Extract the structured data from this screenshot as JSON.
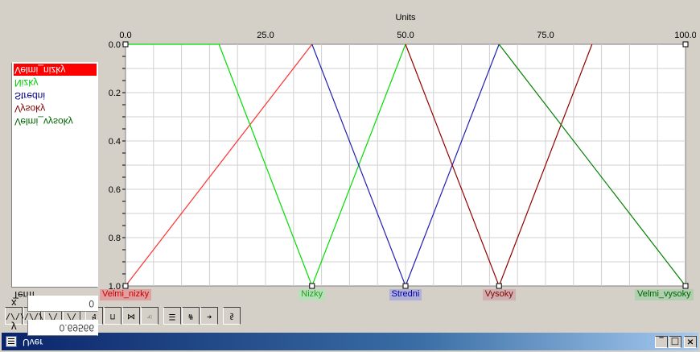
{
  "window": {
    "title": "Uver"
  },
  "titlebar_buttons": [
    "_",
    "□",
    "×"
  ],
  "toolbar": {
    "buttons": [
      {
        "name": "zoom-button-1",
        "label": "\\/\\/"
      },
      {
        "name": "zoom-button-2",
        "label": "\\/\\/"
      },
      {
        "name": "triangle-button",
        "label": "/\\"
      },
      {
        "name": "peak-button",
        "label": "/\\"
      },
      {
        "name": "tool-button-a",
        "label": "↯"
      },
      {
        "name": "tool-button-b",
        "label": "⊓"
      },
      {
        "name": "tool-button-c",
        "label": "⋈"
      },
      {
        "name": "hand-button",
        "label": "☜"
      },
      {
        "name": "list-button",
        "label": "☰"
      },
      {
        "name": "grid-button",
        "label": "#"
      },
      {
        "name": "arrow-button",
        "label": "➜"
      },
      {
        "name": "help-button",
        "label": "§"
      }
    ]
  },
  "term_panel": {
    "label": "Term",
    "terms": [
      {
        "label": "Velmi_nizky",
        "color": "#ff0000",
        "selected": true
      },
      {
        "label": "Nizky",
        "color": "#00cc00"
      },
      {
        "label": "Stredni",
        "color": "#000080"
      },
      {
        "label": "Vysoky",
        "color": "#800000"
      },
      {
        "label": "Velmi_vysoky",
        "color": "#006400"
      }
    ]
  },
  "readouts": {
    "x_label": "x",
    "x_value": "0",
    "y_label": "y",
    "y_value": "0.69566"
  },
  "chart_data": {
    "type": "line",
    "xlabel": "Units",
    "xlim": [
      0,
      100
    ],
    "ylim": [
      0,
      1
    ],
    "x_ticks": [
      "0.0",
      "25.0",
      "50.0",
      "75.0",
      "100.0"
    ],
    "y_ticks": [
      "0.0",
      "0.2",
      "0.4",
      "0.6",
      "0.8",
      "1.0"
    ],
    "series": [
      {
        "name": "Velmi_nizky",
        "color": "#ff3030",
        "x": [
          0,
          33.3
        ],
        "y": [
          1,
          0
        ]
      },
      {
        "name": "Nizky",
        "color": "#00dd00",
        "x": [
          0,
          16.7,
          33.3,
          50
        ],
        "y": [
          0,
          0,
          1,
          0
        ]
      },
      {
        "name": "Stredni",
        "color": "#2020b0",
        "x": [
          33.3,
          50,
          66.7
        ],
        "y": [
          0,
          1,
          0
        ]
      },
      {
        "name": "Vysoky",
        "color": "#900000",
        "x": [
          50,
          66.7,
          83.3
        ],
        "y": [
          0,
          1,
          0
        ]
      },
      {
        "name": "Velmi_vysoky",
        "color": "#008000",
        "x": [
          66.7,
          100
        ],
        "y": [
          0,
          1
        ]
      }
    ],
    "term_labels": [
      {
        "label": "Velmi_nizky",
        "bg": "#e0a0a0",
        "color": "#c00000",
        "x": 0
      },
      {
        "label": "Nizky",
        "bg": "#b8e0b8",
        "color": "#20a020",
        "x": 33.3
      },
      {
        "label": "Stredni",
        "bg": "#b0b0d8",
        "color": "#0000a0",
        "x": 50
      },
      {
        "label": "Vysoky",
        "bg": "#d0b0b0",
        "color": "#800000",
        "x": 66.7
      },
      {
        "label": "Velmi_vysoky",
        "bg": "#b0d0b0",
        "color": "#006000",
        "x": 100
      }
    ]
  }
}
